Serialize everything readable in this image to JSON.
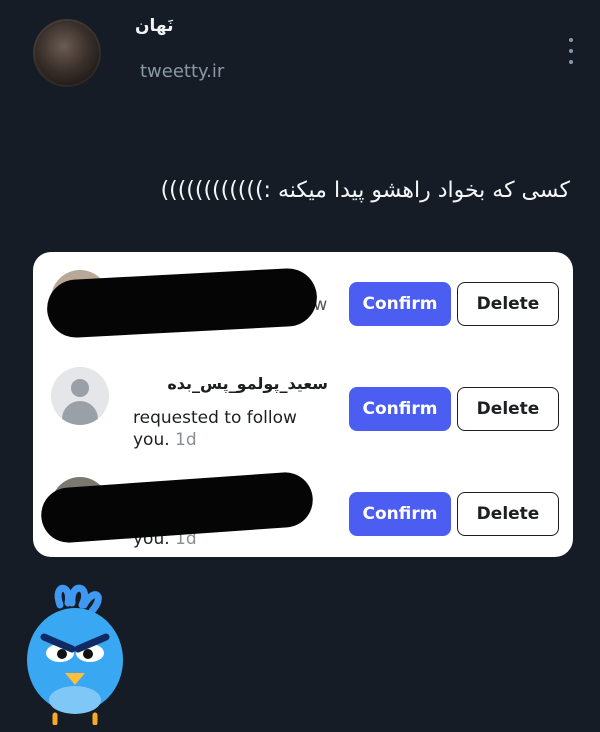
{
  "tweet": {
    "author": "نَهان",
    "handle": "tweetty.ir",
    "text": "کسی که بخواد راهشو پیدا میکنه :))))))))))))"
  },
  "requests": [
    {
      "username": "",
      "text_prefix": "ow",
      "time": "",
      "confirm_label": "Confirm",
      "delete_label": "Delete"
    },
    {
      "username": "سعید_پولمو_پس_بده",
      "text_prefix": "requested to follow you.",
      "time": "1d",
      "confirm_label": "Confirm",
      "delete_label": "Delete"
    },
    {
      "username": "",
      "text_prefix": "you.",
      "time": "1d",
      "confirm_label": "Confirm",
      "delete_label": "Delete"
    }
  ],
  "colors": {
    "background": "#151c26",
    "confirm": "#4c5df2",
    "card": "#ffffff"
  },
  "icons": {
    "more": "more-vertical-icon",
    "default_avatar": "user-silhouette-icon",
    "mascot": "angry-blue-bird-icon"
  }
}
